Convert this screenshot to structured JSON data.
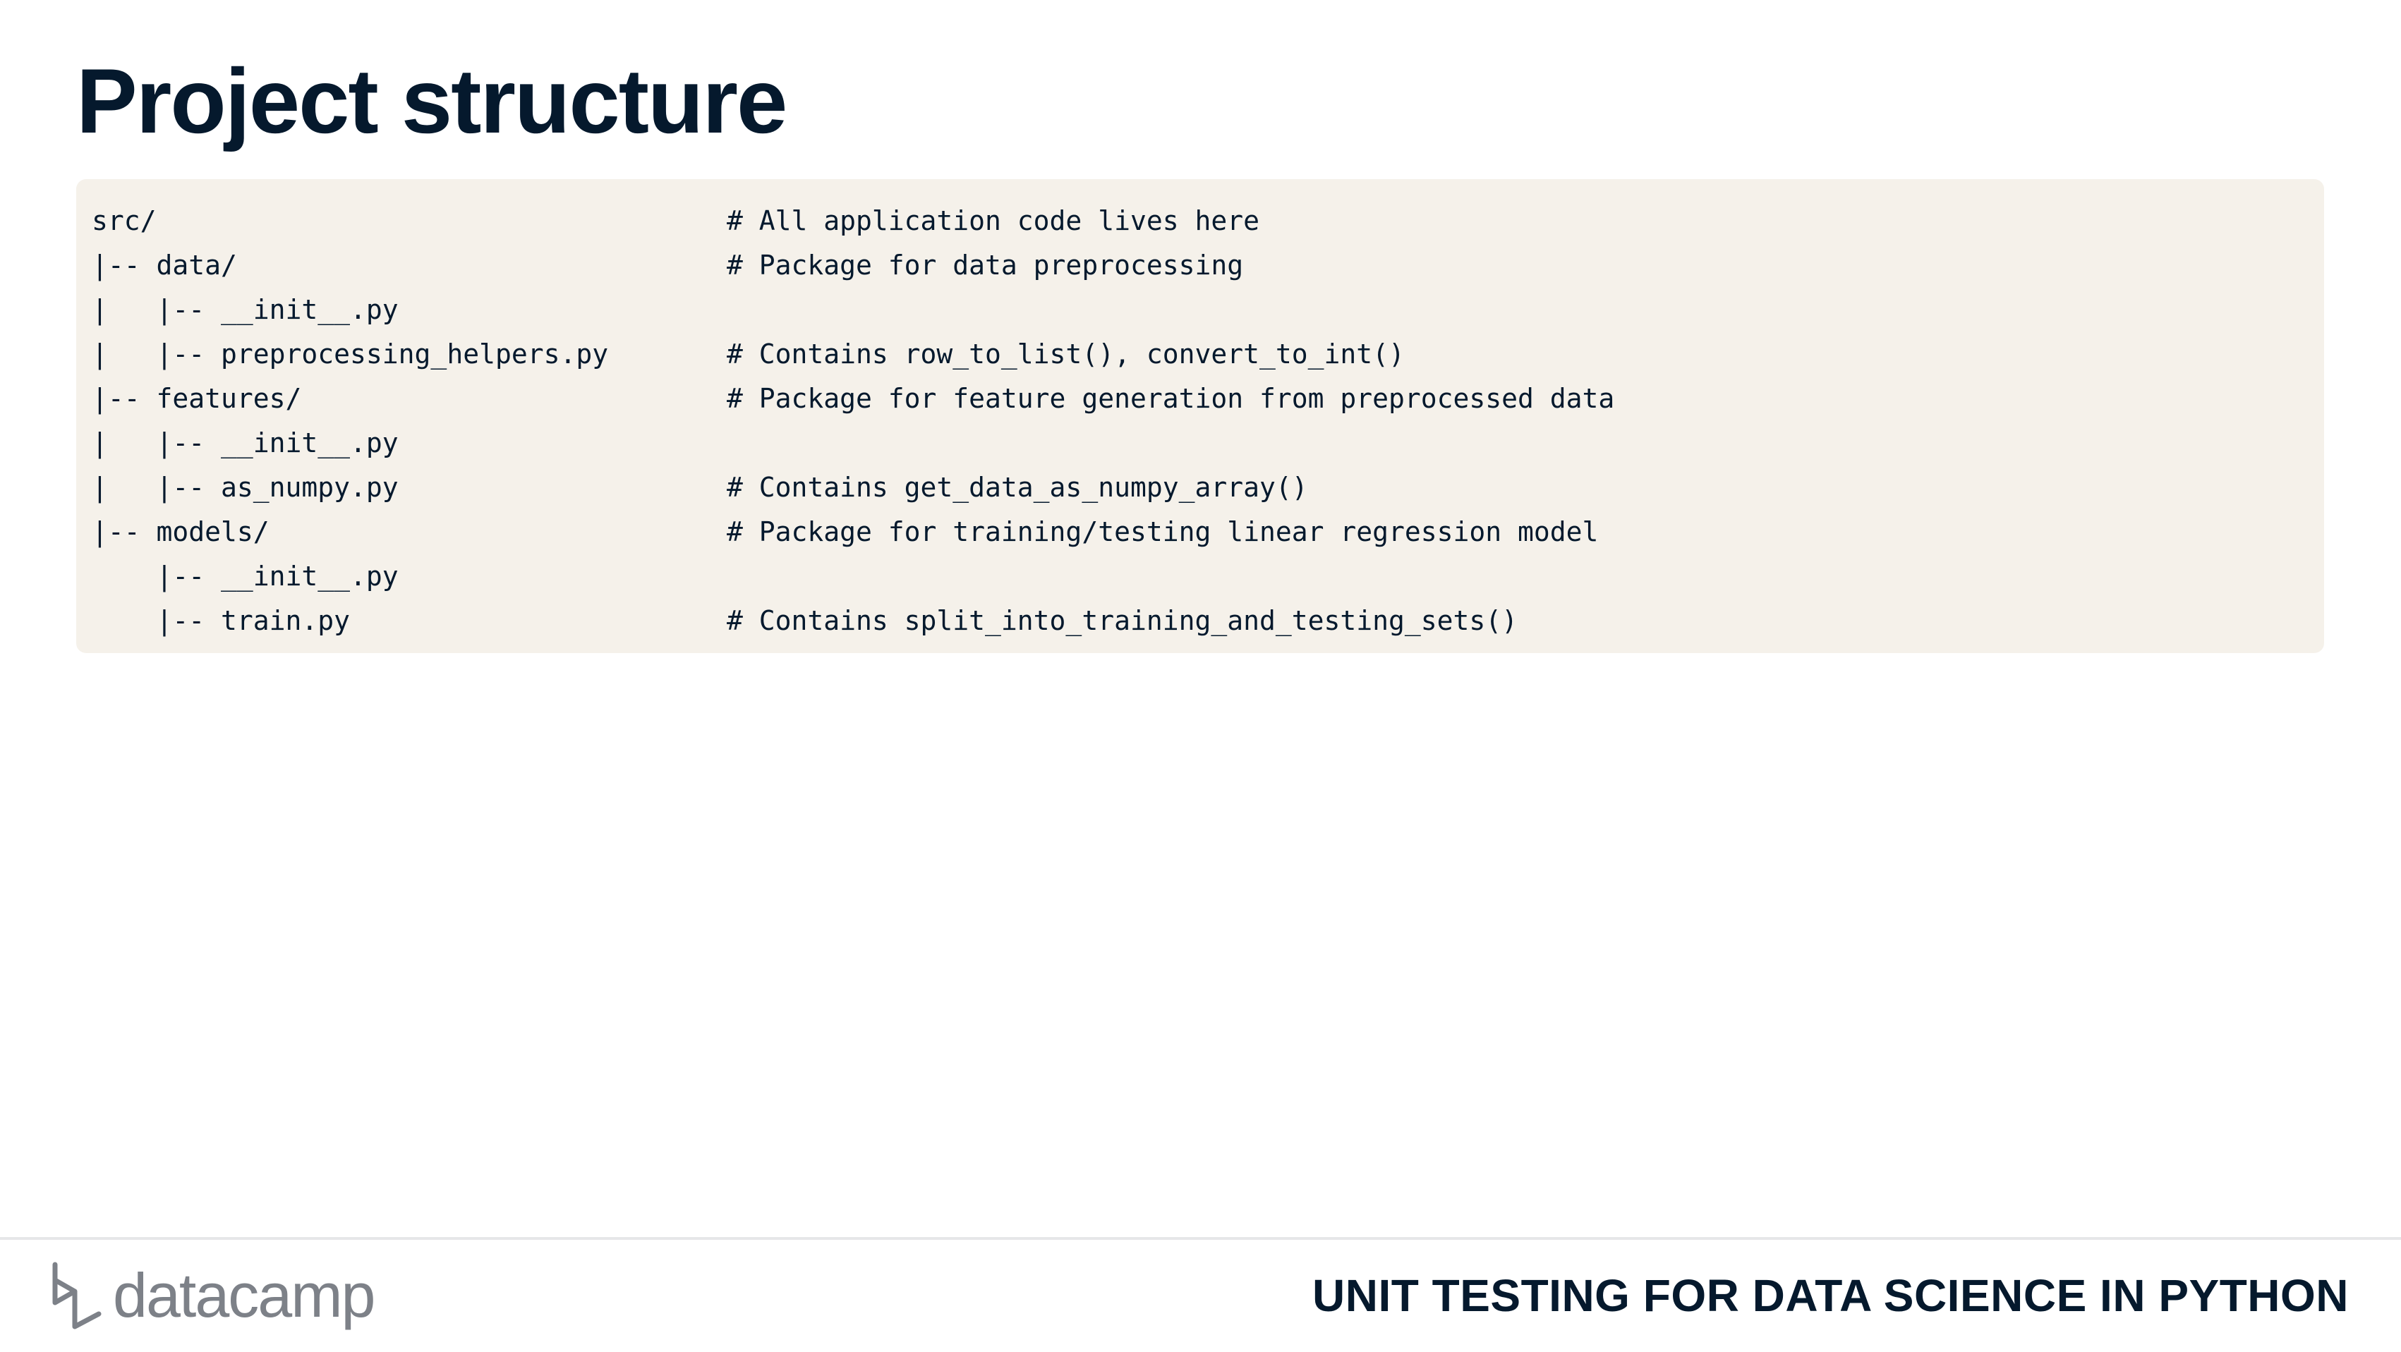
{
  "slide": {
    "title": "Project structure"
  },
  "code_block": {
    "lines": [
      {
        "path": "src/",
        "comment": "# All application code lives here"
      },
      {
        "path": "|-- data/",
        "comment": "# Package for data preprocessing"
      },
      {
        "path": "|   |-- __init__.py",
        "comment": ""
      },
      {
        "path": "|   |-- preprocessing_helpers.py",
        "comment": "# Contains row_to_list(), convert_to_int()"
      },
      {
        "path": "|-- features/",
        "comment": "# Package for feature generation from preprocessed data"
      },
      {
        "path": "|   |-- __init__.py",
        "comment": ""
      },
      {
        "path": "|   |-- as_numpy.py",
        "comment": "# Contains get_data_as_numpy_array()"
      },
      {
        "path": "|-- models/",
        "comment": "# Package for training/testing linear regression model"
      },
      {
        "path": "    |-- __init__.py",
        "comment": ""
      },
      {
        "path": "    |-- train.py",
        "comment": "# Contains split_into_training_and_testing_sets()"
      }
    ]
  },
  "footer": {
    "logo_text": "datacamp",
    "logo_icon": "datacamp-logo-icon",
    "course_title": "UNIT TESTING FOR DATA SCIENCE IN PYTHON"
  },
  "colors": {
    "title": "#05192d",
    "code_background": "#f5f1ea",
    "logo": "#7d8188",
    "divider": "#e6e7e9"
  }
}
